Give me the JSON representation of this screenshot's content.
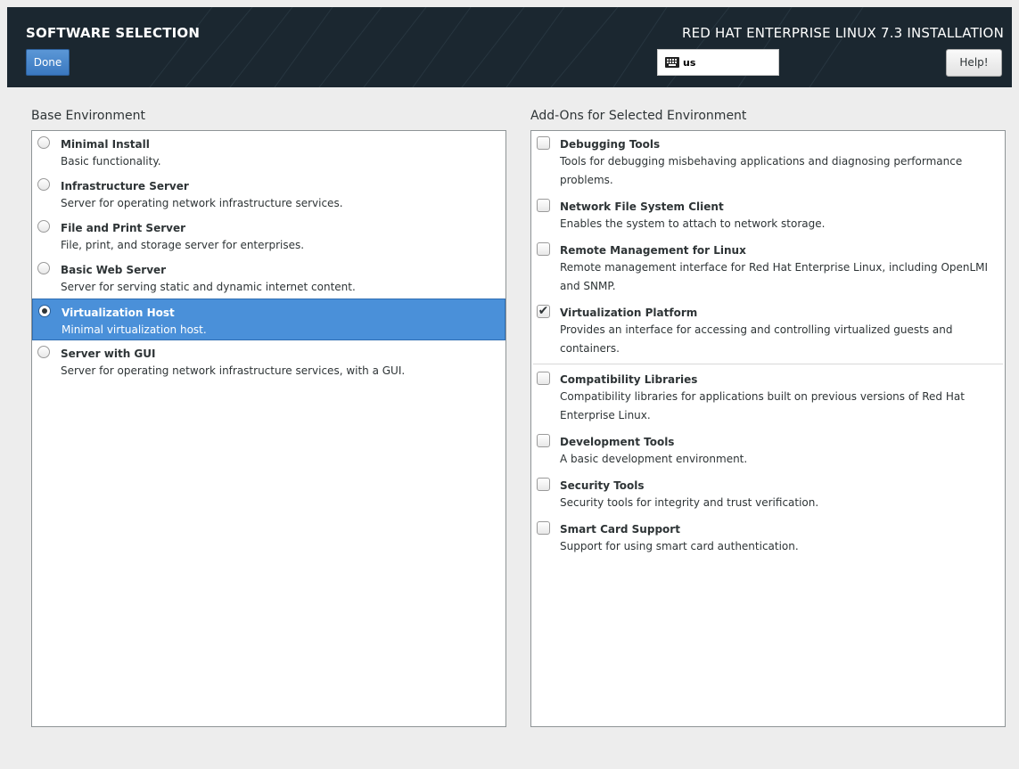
{
  "header": {
    "screen_title": "SOFTWARE SELECTION",
    "done_label": "Done",
    "product_title": "RED HAT ENTERPRISE LINUX 7.3 INSTALLATION",
    "keyboard_layout": "us",
    "keyboard_icon": "keyboard-icon",
    "help_label": "Help!"
  },
  "base": {
    "heading": "Base Environment",
    "items": [
      {
        "name": "Minimal Install",
        "desc": "Basic functionality."
      },
      {
        "name": "Infrastructure Server",
        "desc": "Server for operating network infrastructure services."
      },
      {
        "name": "File and Print Server",
        "desc": "File, print, and storage server for enterprises."
      },
      {
        "name": "Basic Web Server",
        "desc": "Server for serving static and dynamic internet content."
      },
      {
        "name": "Virtualization Host",
        "desc": "Minimal virtualization host."
      },
      {
        "name": "Server with GUI",
        "desc": "Server for operating network infrastructure services, with a GUI."
      }
    ],
    "selected": "Virtualization Host"
  },
  "addons": {
    "heading": "Add-Ons for Selected Environment",
    "items": [
      {
        "name": "Debugging Tools",
        "desc": "Tools for debugging misbehaving applications and diagnosing performance problems.",
        "checked": false
      },
      {
        "name": "Network File System Client",
        "desc": "Enables the system to attach to network storage.",
        "checked": false
      },
      {
        "name": "Remote Management for Linux",
        "desc": "Remote management interface for Red Hat Enterprise Linux, including OpenLMI and SNMP.",
        "checked": false
      },
      {
        "name": "Virtualization Platform",
        "desc": "Provides an interface for accessing and controlling virtualized guests and containers.",
        "checked": true
      },
      {
        "name": "Compatibility Libraries",
        "desc": "Compatibility libraries for applications built on previous versions of Red Hat Enterprise Linux.",
        "checked": false
      },
      {
        "name": "Development Tools",
        "desc": "A basic development environment.",
        "checked": false
      },
      {
        "name": "Security Tools",
        "desc": "Security tools for integrity and trust verification.",
        "checked": false
      },
      {
        "name": "Smart Card Support",
        "desc": "Support for using smart card authentication.",
        "checked": false
      }
    ]
  },
  "colors": {
    "header_bg": "#1d2a33",
    "accent": "#4a90d9",
    "done_button": "#3a78c0"
  }
}
